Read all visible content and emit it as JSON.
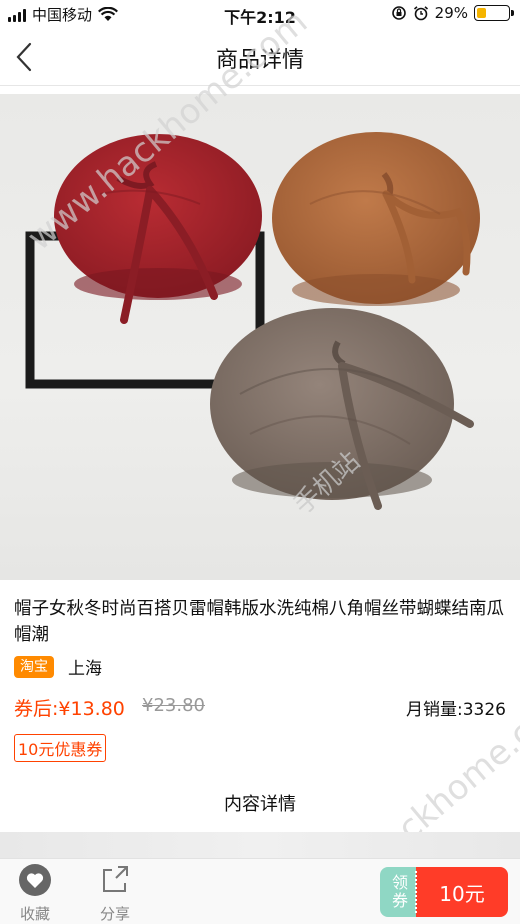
{
  "status_bar": {
    "carrier": "中国移动",
    "time": "下午2:12",
    "battery_percent": "29%",
    "battery_level": 0.29,
    "icons": [
      "signal-icon",
      "wifi-icon",
      "orientation-lock-icon",
      "alarm-icon",
      "battery-icon"
    ]
  },
  "nav": {
    "title": "商品详情",
    "back_icon": "chevron-left-icon"
  },
  "watermarks": {
    "site": "www.hackhome.com",
    "cn": "手机站"
  },
  "product": {
    "title": "帽子女秋冬时尚百搭贝雷帽韩版水洗纯棉八角帽丝带蝴蝶结南瓜帽潮",
    "platform_badge": "淘宝",
    "location": "上海",
    "coupon_price": "券后:¥13.80",
    "original_price": "¥23.80",
    "monthly_sales": "月销量:3326",
    "coupon_tag": "10元优惠券",
    "colors": {
      "red_beret": "#a8242c",
      "tan_beret": "#b06a3e",
      "grey_beret": "#857468"
    }
  },
  "detail": {
    "header": "内容详情"
  },
  "bottom_bar": {
    "favorite_label": "收藏",
    "share_label": "分享",
    "coupon_left": "领券",
    "coupon_right": "10元"
  },
  "colors": {
    "accent": "#ff4200",
    "badge": "#ff8a00",
    "coupon_green": "#8fd7c4",
    "coupon_red": "#ff3c28"
  }
}
